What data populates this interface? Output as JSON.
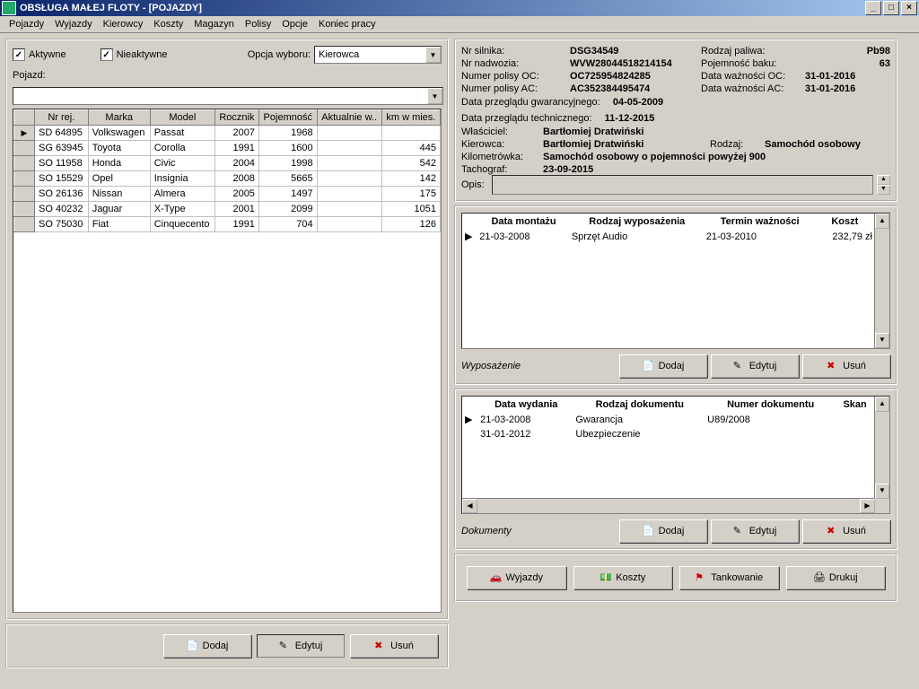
{
  "window": {
    "title": "OBSŁUGA MAŁEJ FLOTY - [POJAZDY]"
  },
  "menu": [
    "Pojazdy",
    "Wyjazdy",
    "Kierowcy",
    "Koszty",
    "Magazyn",
    "Polisy",
    "Opcje",
    "Koniec pracy"
  ],
  "filter": {
    "aktywne_label": "Aktywne",
    "aktywne_check": "✓",
    "nieaktywne_label": "Nieaktywne",
    "nieaktywne_check": "✓",
    "opcja_label": "Opcja wyboru:",
    "opcja_value": "Kierowca",
    "pojazd_label": "Pojazd:",
    "pojazd_value": ""
  },
  "vehicles": {
    "headers": [
      "Nr rej.",
      "Marka",
      "Model",
      "Rocznik",
      "Pojemność",
      "Aktualnie w..",
      "km w mies."
    ],
    "rows": [
      {
        "mark": "▶",
        "c": [
          "SD 64895",
          "Volkswagen",
          "Passat",
          "2007",
          "1968",
          "",
          ""
        ]
      },
      {
        "mark": "",
        "c": [
          "SG 63945",
          "Toyota",
          "Corolla",
          "1991",
          "1600",
          "",
          "445"
        ]
      },
      {
        "mark": "",
        "c": [
          "SO 11958",
          "Honda",
          "Civic",
          "2004",
          "1998",
          "",
          "542"
        ]
      },
      {
        "mark": "",
        "c": [
          "SO 15529",
          "Opel",
          "Insignia",
          "2008",
          "5665",
          "",
          "142"
        ]
      },
      {
        "mark": "",
        "c": [
          "SO 26136",
          "Nissan",
          "Almera",
          "2005",
          "1497",
          "",
          "175"
        ]
      },
      {
        "mark": "",
        "c": [
          "SO 40232",
          "Jaguar",
          "X-Type",
          "2001",
          "2099",
          "",
          "1051"
        ]
      },
      {
        "mark": "",
        "c": [
          "SO 75030",
          "Fiat",
          "Cinquecento",
          "1991",
          "704",
          "",
          "126"
        ]
      }
    ]
  },
  "vehicle_buttons": {
    "dodaj": "Dodaj",
    "edytuj": "Edytuj",
    "usun": "Usuń"
  },
  "info": {
    "nr_silnika_l": "Nr silnika:",
    "nr_silnika_v": "DSG34549",
    "rodzaj_paliwa_l": "Rodzaj paliwa:",
    "rodzaj_paliwa_v": "Pb98",
    "nr_nadwozia_l": "Nr nadwozia:",
    "nr_nadwozia_v": "WVW28044518214154",
    "poj_baku_l": "Pojemność baku:",
    "poj_baku_v": "63",
    "numer_oc_l": "Numer polisy OC:",
    "numer_oc_v": "OC725954824285",
    "data_oc_l": "Data ważności OC:",
    "data_oc_v": "31-01-2016",
    "numer_ac_l": "Numer polisy AC:",
    "numer_ac_v": "AC352384495474",
    "data_ac_l": "Data ważności AC:",
    "data_ac_v": "31-01-2016",
    "przeg_gwar_l": "Data przeglądu gwarancyjnego:",
    "przeg_gwar_v": "04-05-2009",
    "przeg_tech_l": "Data przeglądu technicznego:",
    "przeg_tech_v": "11-12-2015",
    "wlasciciel_l": "Właściciel:",
    "wlasciciel_v": "Bartłomiej Dratwiński",
    "kierowca_l": "Kierowca:",
    "kierowca_v": "Bartłomiej Dratwiński",
    "rodzaj_l": "Rodzaj:",
    "rodzaj_v": "Samochód osobowy",
    "kilometrowka_l": "Kilometrówka:",
    "kilometrowka_v": "Samochód osobowy o pojemności powyżej 900",
    "tachograf_l": "Tachograf:",
    "tachograf_v": "23-09-2015",
    "opis_l": "Opis:"
  },
  "equipment": {
    "title": "Wyposażenie",
    "headers": [
      "Data montażu",
      "Rodzaj wyposażenia",
      "Termin ważności",
      "Koszt"
    ],
    "rows": [
      {
        "mark": "▶",
        "c": [
          "21-03-2008",
          "Sprzęt Audio",
          "21-03-2010",
          "232,79 zł"
        ]
      }
    ],
    "btn": {
      "dodaj": "Dodaj",
      "edytuj": "Edytuj",
      "usun": "Usuń"
    }
  },
  "documents": {
    "title": "Dokumenty",
    "headers": [
      "Data wydania",
      "Rodzaj dokumentu",
      "Numer dokumentu",
      "Skan"
    ],
    "rows": [
      {
        "mark": "▶",
        "c": [
          "21-03-2008",
          "Gwarancja",
          "U89/2008",
          ""
        ]
      },
      {
        "mark": "",
        "c": [
          "31-01-2012",
          "Ubezpieczenie",
          "",
          ""
        ]
      }
    ],
    "btn": {
      "dodaj": "Dodaj",
      "edytuj": "Edytuj",
      "usun": "Usuń"
    }
  },
  "bottom": {
    "wyjazdy": "Wyjazdy",
    "koszty": "Koszty",
    "tankowanie": "Tankowanie",
    "drukuj": "Drukuj"
  }
}
